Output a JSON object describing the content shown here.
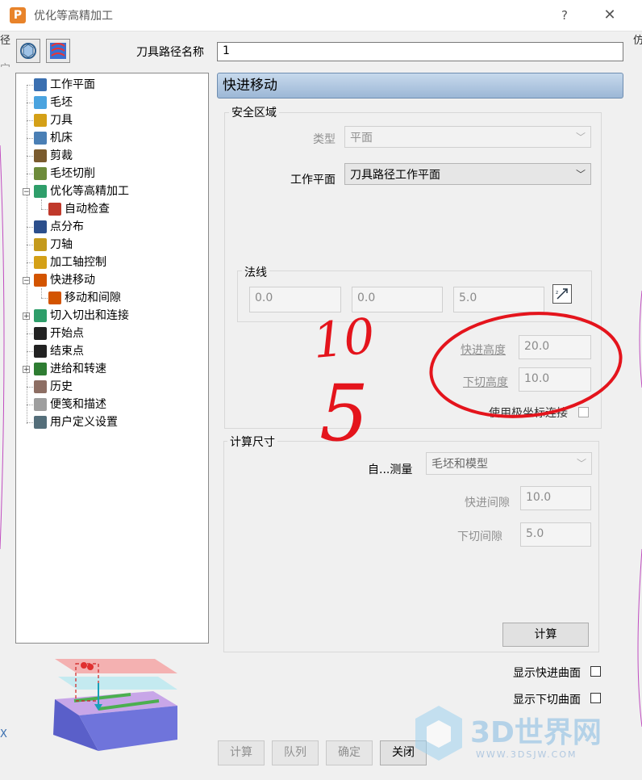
{
  "window": {
    "title": "优化等高精加工",
    "help_label": "?",
    "close_label": "✕",
    "app_icon_letter": "P"
  },
  "background_fragments": {
    "left_top": "径",
    "right_top": "仿",
    "left_mid": "宀",
    "left_bottom": "X"
  },
  "toolbar": {
    "icons": [
      "strategy-icon",
      "toolpath-pattern-icon"
    ]
  },
  "toolpath_name": {
    "label": "刀具路径名称",
    "value": "1"
  },
  "tree": {
    "items": [
      {
        "label": "工作平面",
        "icon": "workplane-icon",
        "color": "#3a6fb0"
      },
      {
        "label": "毛坯",
        "icon": "block-icon",
        "color": "#4aa3df"
      },
      {
        "label": "刀具",
        "icon": "tool-icon",
        "color": "#d4a017"
      },
      {
        "label": "机床",
        "icon": "machine-icon",
        "color": "#4a7fb5"
      },
      {
        "label": "剪裁",
        "icon": "trim-icon",
        "color": "#7a5b2e"
      },
      {
        "label": "毛坯切削",
        "icon": "block-cut-icon",
        "color": "#6d8b3a"
      },
      {
        "label": "优化等高精加工",
        "icon": "strategy-icon",
        "color": "#2e9e6a"
      },
      {
        "label": "自动检查",
        "icon": "auto-check-icon",
        "color": "#c0392b"
      },
      {
        "label": "点分布",
        "icon": "point-distribution-icon",
        "color": "#2c4f8c"
      },
      {
        "label": "刀轴",
        "icon": "tool-axis-icon",
        "color": "#c49a1c"
      },
      {
        "label": "加工轴控制",
        "icon": "axis-control-icon",
        "color": "#d4a017"
      },
      {
        "label": "快进移动",
        "icon": "rapid-move-icon",
        "color": "#d35400"
      },
      {
        "label": "移动和间隙",
        "icon": "moves-clearance-icon",
        "color": "#d35400"
      },
      {
        "label": "切入切出和连接",
        "icon": "leads-links-icon",
        "color": "#2e9e6a"
      },
      {
        "label": "开始点",
        "icon": "start-point-icon",
        "color": "#222222"
      },
      {
        "label": "结束点",
        "icon": "end-point-icon",
        "color": "#222222"
      },
      {
        "label": "进给和转速",
        "icon": "feeds-speeds-icon",
        "color": "#2e7d32"
      },
      {
        "label": "历史",
        "icon": "history-icon",
        "color": "#8d6e63"
      },
      {
        "label": "便笺和描述",
        "icon": "notes-icon",
        "color": "#9e9e9e"
      },
      {
        "label": "用户定义设置",
        "icon": "user-settings-icon",
        "color": "#546e7a"
      }
    ]
  },
  "panel": {
    "header": "快进移动",
    "safe_area": {
      "title": "安全区域",
      "type_label": "类型",
      "type_value": "平面",
      "workplane_label": "工作平面",
      "workplane_value": "刀具路径工作平面",
      "normal": {
        "title": "法线",
        "x": "0.0",
        "y": "0.0",
        "z": "5.0",
        "pick_icon": "pick-direction-icon"
      },
      "rapid_height_label": "快进高度",
      "rapid_height_value": "20.0",
      "plunge_height_label": "下切高度",
      "plunge_height_value": "10.0",
      "polar_label": "使用极坐标连接",
      "polar_checked": false
    },
    "calc_dims": {
      "title": "计算尺寸",
      "auto_measure_label": "自...测量",
      "auto_measure_value": "毛坯和模型",
      "rapid_gap_label": "快进间隙",
      "rapid_gap_value": "10.0",
      "plunge_gap_label": "下切间隙",
      "plunge_gap_value": "5.0",
      "calc_button": "计算"
    },
    "show_rapid_surface_label": "显示快进曲面",
    "show_plunge_surface_label": "显示下切曲面"
  },
  "footer_buttons": {
    "calc": "计算",
    "queue": "队列",
    "ok": "确定",
    "close": "关闭"
  },
  "annotation": {
    "handwritten_top": "10",
    "handwritten_bottom": "5",
    "color": "#e4141c"
  },
  "watermark": {
    "brand": "3D世界网",
    "url": "WWW.3DSJW.COM"
  }
}
